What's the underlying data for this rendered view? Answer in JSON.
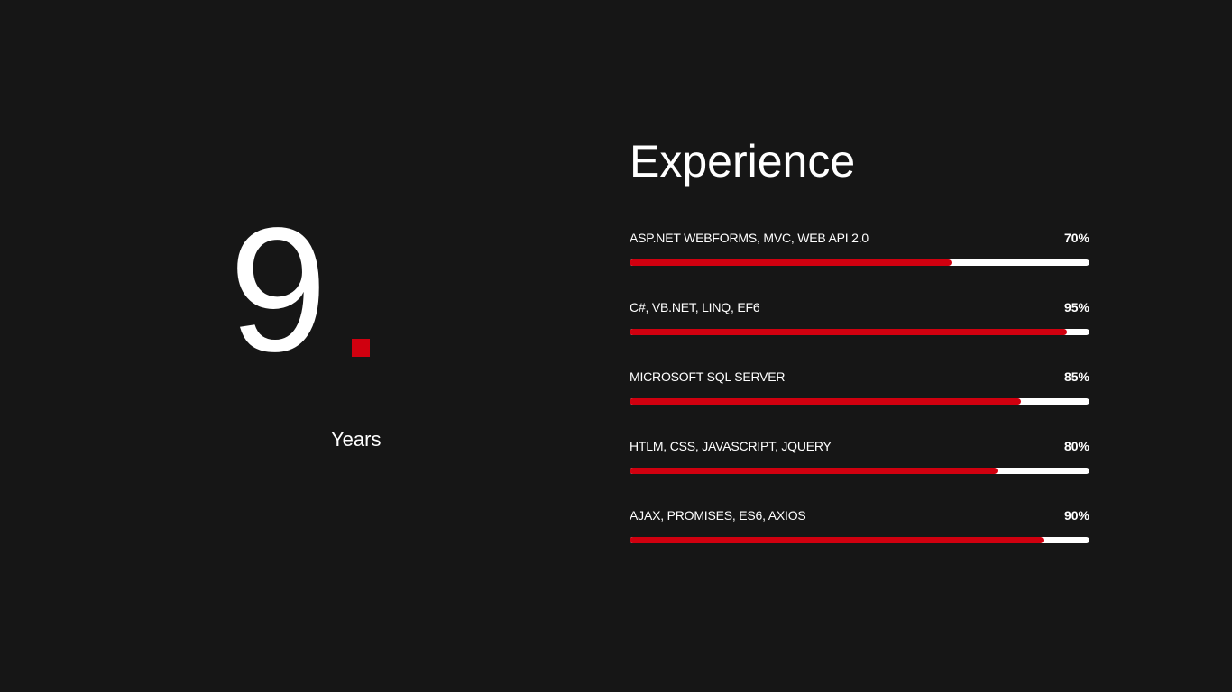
{
  "years_panel": {
    "number": "9",
    "label": "Years"
  },
  "experience": {
    "heading": "Experience",
    "accent_color": "#d0000f",
    "skills": [
      {
        "name": "ASP.NET WEBFORMS, MVC, WEB API 2.0",
        "percent_label": "70%",
        "level": 70
      },
      {
        "name": "C#, VB.NET, LINQ, EF6",
        "percent_label": "95%",
        "level": 95
      },
      {
        "name": "MICROSOFT SQL SERVER",
        "percent_label": "85%",
        "level": 85
      },
      {
        "name": "HTLM, CSS, JAVASCRIPT, JQUERY",
        "percent_label": "80%",
        "level": 80
      },
      {
        "name": "AJAX, PROMISES, ES6, AXIOS",
        "percent_label": "90%",
        "level": 90
      }
    ]
  }
}
